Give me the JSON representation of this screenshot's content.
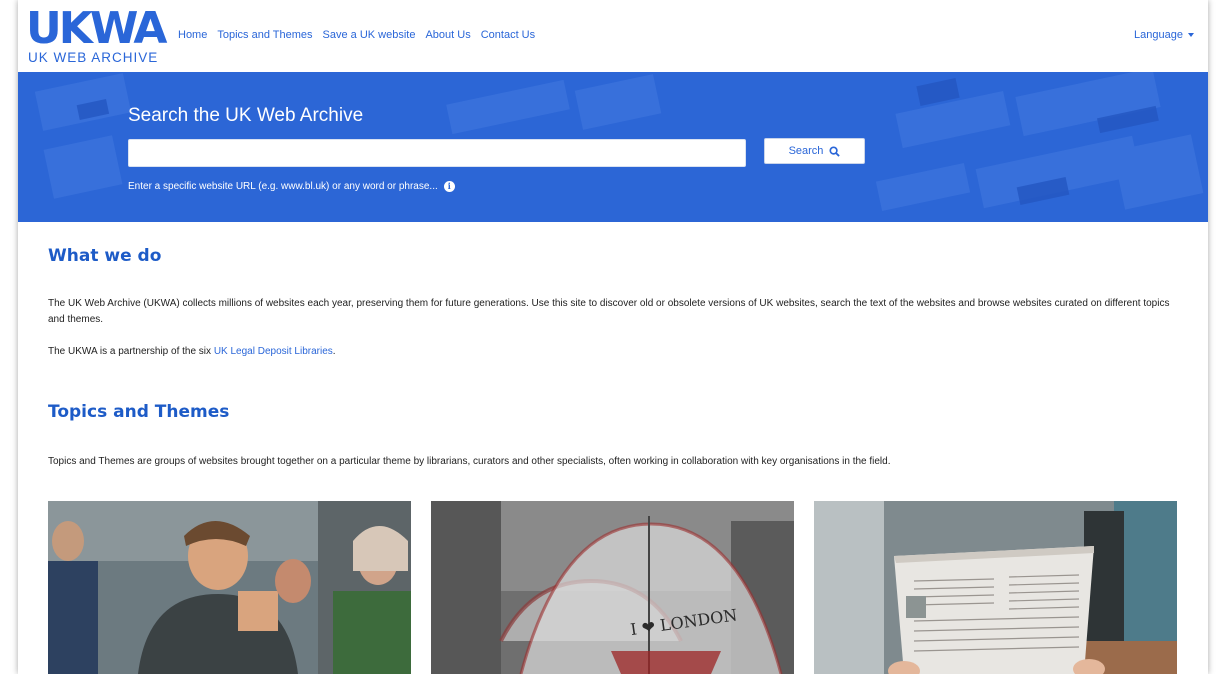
{
  "header": {
    "logo_mark": "UKWA",
    "logo_sub": "UK WEB ARCHIVE",
    "nav": [
      {
        "label": "Home"
      },
      {
        "label": "Topics and Themes"
      },
      {
        "label": "Save a UK website"
      },
      {
        "label": "About Us"
      },
      {
        "label": "Contact Us"
      }
    ],
    "language_label": "Language"
  },
  "hero": {
    "title": "Search the UK Web Archive",
    "search_value": "",
    "search_button_label": "Search",
    "hint": "Enter a specific website URL (e.g. www.bl.uk) or any word or phrase...",
    "accent_color": "#2c66d6"
  },
  "what_we_do": {
    "title": "What we do",
    "paragraph1": "The UK Web Archive (UKWA) collects millions of websites each year, preserving them for future generations. Use this site to discover old or obsolete versions of UK websites, search the text of the websites and browse websites curated on different topics and themes.",
    "paragraph2_prefix": "The UKWA is a partnership of the six ",
    "paragraph2_link": "UK Legal Deposit Libraries",
    "paragraph2_suffix": "."
  },
  "topics": {
    "title": "Topics and Themes",
    "description": "Topics and Themes are groups of websites brought together on a particular theme by librarians, curators and other specialists, often working in collaboration with key organisations in the field."
  },
  "cards": [
    {
      "icon": "people-photo"
    },
    {
      "icon": "umbrella-photo",
      "printed_text": "I ❤ LONDON"
    },
    {
      "icon": "newspaper-photo"
    }
  ]
}
